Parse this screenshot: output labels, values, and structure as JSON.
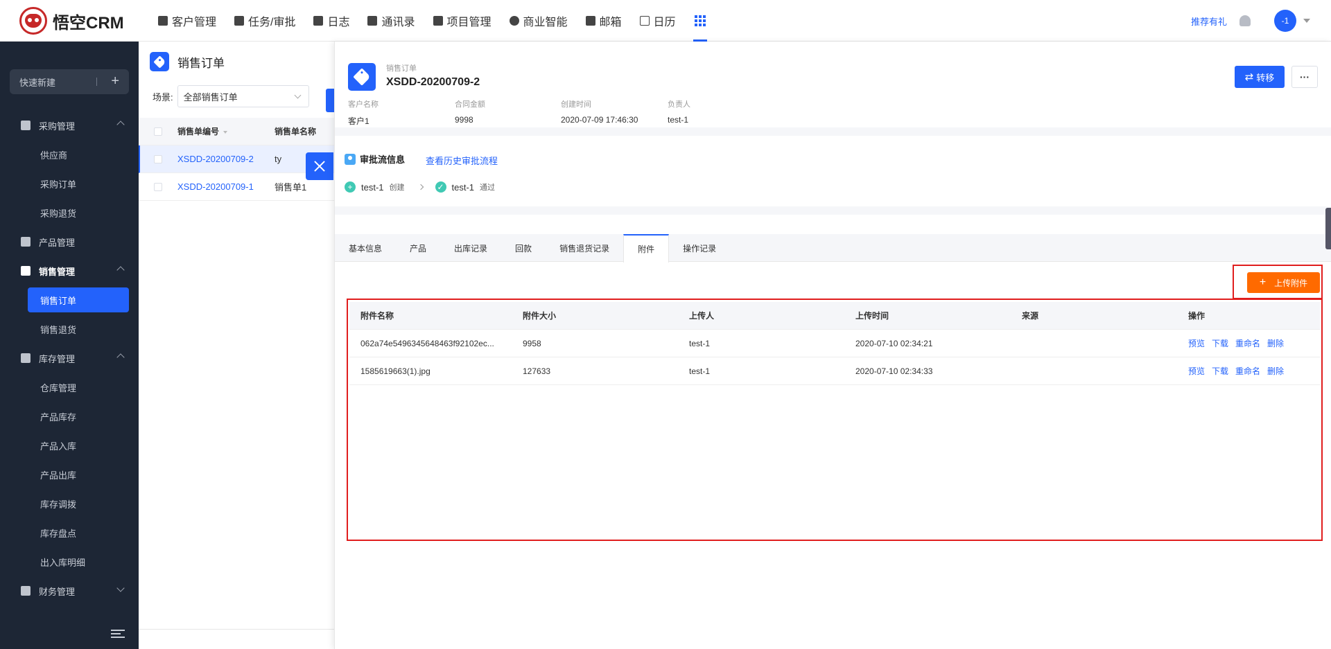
{
  "brand": {
    "name": "悟空CRM"
  },
  "nav": {
    "items": [
      {
        "label": "客户管理",
        "icon": "building-icon"
      },
      {
        "label": "任务/审批",
        "icon": "briefcase-icon"
      },
      {
        "label": "日志",
        "icon": "log-icon"
      },
      {
        "label": "通讯录",
        "icon": "contacts-icon"
      },
      {
        "label": "项目管理",
        "icon": "project-icon"
      },
      {
        "label": "商业智能",
        "icon": "bi-icon"
      },
      {
        "label": "邮箱",
        "icon": "mail-icon"
      },
      {
        "label": "日历",
        "icon": "calendar-icon"
      }
    ],
    "gift_link": "推荐有礼",
    "avatar_text": "-1"
  },
  "sidebar": {
    "quick_new": "快速新建",
    "groups": [
      {
        "label": "采购管理",
        "expanded": true,
        "items": [
          "供应商",
          "采购订单",
          "采购退货"
        ]
      },
      {
        "label": "产品管理"
      },
      {
        "label": "销售管理",
        "expanded": true,
        "active": true,
        "items": [
          "销售订单",
          "销售退货"
        ]
      },
      {
        "label": "库存管理",
        "expanded": true,
        "items": [
          "仓库管理",
          "产品库存",
          "产品入库",
          "产品出库",
          "库存调拨",
          "库存盘点",
          "出入库明细"
        ]
      },
      {
        "label": "财务管理",
        "expanded": false
      }
    ],
    "active_item": "销售订单"
  },
  "list": {
    "title": "销售订单",
    "scene_label": "场景:",
    "scene_value": "全部销售订单",
    "columns": [
      "销售单编号",
      "销售单名称"
    ],
    "rows": [
      {
        "no": "XSDD-20200709-2",
        "name": "ty",
        "selected": true
      },
      {
        "no": "XSDD-20200709-1",
        "name": "销售单1",
        "selected": false
      }
    ]
  },
  "detail": {
    "type_label": "销售订单",
    "title": "XSDD-20200709-2",
    "meta": [
      {
        "key": "客户名称",
        "value": "客户1"
      },
      {
        "key": "合同金额",
        "value": "9998"
      },
      {
        "key": "创建时间",
        "value": "2020-07-09 17:46:30"
      },
      {
        "key": "负责人",
        "value": "test-1"
      }
    ],
    "transfer_label": "转移",
    "more_label": "···",
    "approval": {
      "title": "审批流信息",
      "history_link": "查看历史审批流程",
      "steps": [
        {
          "who": "test-1",
          "action": "创建"
        },
        {
          "who": "test-1",
          "action": "通过"
        }
      ]
    },
    "tabs": [
      "基本信息",
      "产品",
      "出库记录",
      "回款",
      "销售退货记录",
      "附件",
      "操作记录"
    ],
    "active_tab": "附件",
    "upload_label": "上传附件",
    "files": {
      "columns": [
        "附件名称",
        "附件大小",
        "上传人",
        "上传时间",
        "来源",
        "操作"
      ],
      "rows": [
        {
          "name": "062a74e5496345648463f92102ec...",
          "size": "9958",
          "uploader": "test-1",
          "time": "2020-07-10 02:34:21",
          "source": ""
        },
        {
          "name": "1585619663(1).jpg",
          "size": "127633",
          "uploader": "test-1",
          "time": "2020-07-10 02:34:33",
          "source": ""
        }
      ],
      "actions": [
        "预览",
        "下载",
        "重命名",
        "删除"
      ]
    }
  }
}
